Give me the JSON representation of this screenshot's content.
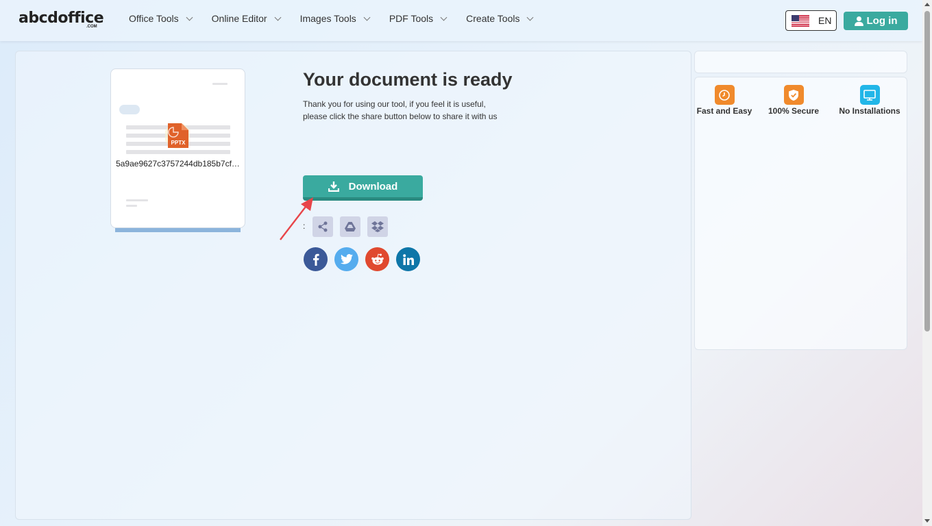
{
  "header": {
    "logo": "abcdoffice",
    "logo_suffix": ".COM",
    "nav": [
      {
        "label": "Office Tools"
      },
      {
        "label": "Online Editor"
      },
      {
        "label": "Images Tools"
      },
      {
        "label": "PDF Tools"
      },
      {
        "label": "Create Tools"
      }
    ],
    "language": "EN",
    "login_label": "Log in"
  },
  "main": {
    "title": "Your document is ready",
    "subtitle_line1": "Thank you for using our tool, if you feel it is useful,",
    "subtitle_line2": "please click the share button below to share it with us",
    "file_badge": "PPTX",
    "filename": "5a9ae9627c3757244db185b7cf…",
    "download_label": "Download",
    "share_prefix": ":",
    "share_icons": [
      "share-icon",
      "google-drive-icon",
      "dropbox-icon"
    ],
    "social_icons": [
      "facebook-icon",
      "twitter-icon",
      "reddit-icon",
      "linkedin-icon"
    ],
    "social_colors": [
      "#3b5998",
      "#55acee",
      "#e0492f",
      "#0e76a8"
    ]
  },
  "features": [
    {
      "label": "Fast and Easy",
      "icon": "clock-icon",
      "color": "#f08a2c"
    },
    {
      "label": "100% Secure",
      "icon": "shield-icon",
      "color": "#f08a2c"
    },
    {
      "label": "No Installations",
      "icon": "monitor-icon",
      "color": "#22b6e8"
    }
  ],
  "colors": {
    "accent": "#3aaa9f",
    "pptx_orange": "#e0622a"
  }
}
